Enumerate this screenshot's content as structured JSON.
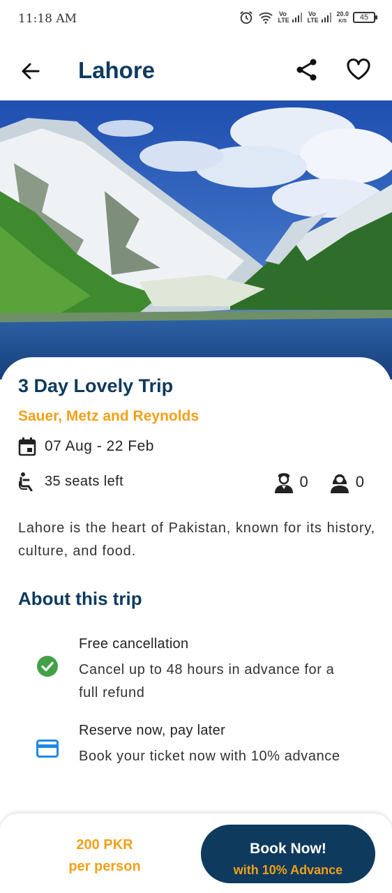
{
  "status_bar": {
    "time": "11:18 AM",
    "network_speed": "20.0",
    "network_unit": "K/S",
    "battery": "45",
    "sim1": "Vo LTE",
    "sim2": "Vo LTE"
  },
  "header": {
    "title": "Lahore",
    "icons": [
      "back-arrow-icon",
      "share-icon",
      "heart-icon"
    ]
  },
  "trip": {
    "title": "3 Day Lovely Trip",
    "company": "Sauer, Metz and Reynolds",
    "dates": "07 Aug - 22 Feb",
    "seats": "35 seats left",
    "male_count": "0",
    "female_count": "0",
    "description": "Lahore is the heart of Pakistan, known for its history, culture, and food."
  },
  "about": {
    "title": "About this trip",
    "features": [
      {
        "icon": "check-circle-icon",
        "title": "Free cancellation",
        "description": "Cancel up to 48 hours in advance for a full refund"
      },
      {
        "icon": "credit-card-icon",
        "title": "Reserve now, pay later",
        "description": "Book your ticket now with 10% advance"
      }
    ]
  },
  "footer": {
    "price": "200 PKR",
    "price_unit": "per person",
    "book_label": "Book Now!",
    "book_sub": "with 10% Advance"
  },
  "colors": {
    "primary": "#0e3a5d",
    "accent": "#f2a01a",
    "success": "#43a047",
    "info": "#1e88e5"
  }
}
